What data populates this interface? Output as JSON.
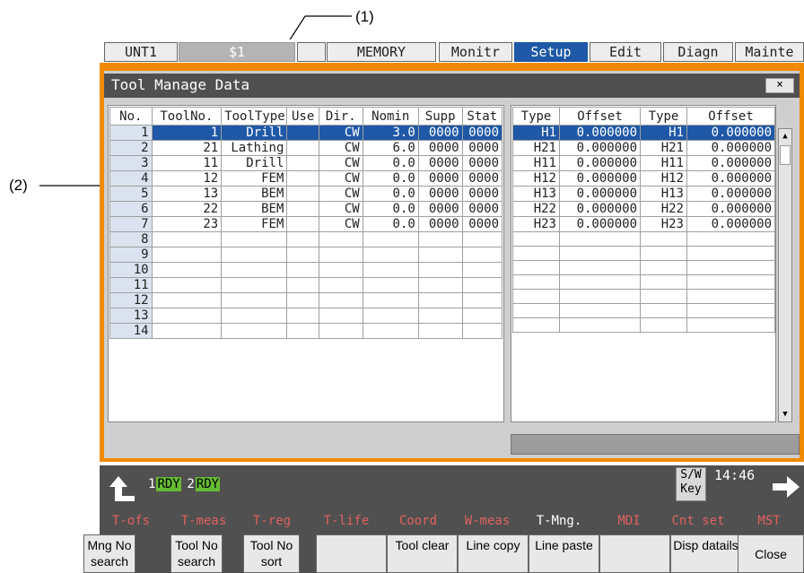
{
  "callouts": {
    "c1": "(1)",
    "c2": "(2)"
  },
  "top_tabs": [
    "UNT1",
    "$1",
    "",
    "MEMORY",
    "Monitr",
    "Setup",
    "Edit",
    "Diagn",
    "Mainte"
  ],
  "window": {
    "title": "Tool Manage Data",
    "close": "×"
  },
  "left_table": {
    "headers": [
      "No.",
      "ToolNo.",
      "ToolType",
      "Use",
      "Dir.",
      "Nomin",
      "Supp",
      "Stat"
    ],
    "rows": [
      [
        "1",
        "1",
        "Drill",
        "",
        "CW",
        "3.0",
        "0000",
        "0000"
      ],
      [
        "2",
        "21",
        "Lathing",
        "",
        "CW",
        "6.0",
        "0000",
        "0000"
      ],
      [
        "3",
        "11",
        "Drill",
        "",
        "CW",
        "0.0",
        "0000",
        "0000"
      ],
      [
        "4",
        "12",
        "FEM",
        "",
        "CW",
        "0.0",
        "0000",
        "0000"
      ],
      [
        "5",
        "13",
        "BEM",
        "",
        "CW",
        "0.0",
        "0000",
        "0000"
      ],
      [
        "6",
        "22",
        "BEM",
        "",
        "CW",
        "0.0",
        "0000",
        "0000"
      ],
      [
        "7",
        "23",
        "FEM",
        "",
        "CW",
        "0.0",
        "0000",
        "0000"
      ],
      [
        "8",
        "",
        "",
        "",
        "",
        "",
        "",
        ""
      ],
      [
        "9",
        "",
        "",
        "",
        "",
        "",
        "",
        ""
      ],
      [
        "10",
        "",
        "",
        "",
        "",
        "",
        "",
        ""
      ],
      [
        "11",
        "",
        "",
        "",
        "",
        "",
        "",
        ""
      ],
      [
        "12",
        "",
        "",
        "",
        "",
        "",
        "",
        ""
      ],
      [
        "13",
        "",
        "",
        "",
        "",
        "",
        "",
        ""
      ],
      [
        "14",
        "",
        "",
        "",
        "",
        "",
        "",
        ""
      ]
    ]
  },
  "right_table": {
    "headers": [
      "Type",
      "Offset",
      "Type",
      "Offset"
    ],
    "rows": [
      [
        "H1",
        "0.000000",
        "H1",
        "0.000000"
      ],
      [
        "H21",
        "0.000000",
        "H21",
        "0.000000"
      ],
      [
        "H11",
        "0.000000",
        "H11",
        "0.000000"
      ],
      [
        "H12",
        "0.000000",
        "H12",
        "0.000000"
      ],
      [
        "H13",
        "0.000000",
        "H13",
        "0.000000"
      ],
      [
        "H22",
        "0.000000",
        "H22",
        "0.000000"
      ],
      [
        "H23",
        "0.000000",
        "H23",
        "0.000000"
      ],
      [
        "",
        "",
        "",
        ""
      ],
      [
        "",
        "",
        "",
        ""
      ],
      [
        "",
        "",
        "",
        ""
      ],
      [
        "",
        "",
        "",
        ""
      ],
      [
        "",
        "",
        "",
        ""
      ],
      [
        "",
        "",
        "",
        ""
      ],
      [
        "",
        "",
        "",
        ""
      ]
    ]
  },
  "status": {
    "n1": "1",
    "rdy1": "RDY",
    "n2": "2",
    "rdy2": "RDY",
    "sw_key": "S/W Key",
    "time": "14:46"
  },
  "menu_labels": [
    "T-ofs",
    "T-meas",
    "T-reg",
    "T-life",
    "Coord",
    "W-meas",
    "T-Mng.",
    "MDI",
    "Cnt set",
    "MST"
  ],
  "function_keys": [
    "Mng No search",
    "Tool No search",
    "Tool No sort",
    "",
    "Tool clear",
    "Line copy",
    "Line paste",
    "",
    "Disp datails",
    "Close"
  ],
  "colors": {
    "frame": "#f08a00",
    "selection": "#1e58a6",
    "active_tab": "#1e58a6",
    "rdy": "#66bb33"
  }
}
